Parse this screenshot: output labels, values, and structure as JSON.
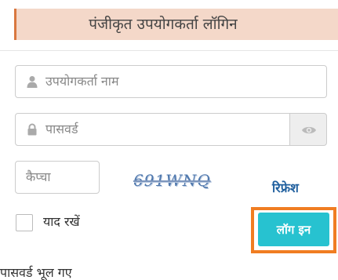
{
  "header": {
    "title": "पंजीकृत उपयोगकर्ता लॉगिन"
  },
  "form": {
    "username": {
      "placeholder": "उपयोगकर्ता नाम",
      "value": "",
      "icon": "user-icon"
    },
    "password": {
      "placeholder": "पासवर्ड",
      "value": "",
      "icon": "lock-icon",
      "toggle_icon": "eye-icon"
    },
    "captcha": {
      "placeholder": "कैप्चा",
      "value": "",
      "image_text": "691WNQ",
      "refresh_label": "रिफ्रेश"
    },
    "remember_me": {
      "label": "याद रखें",
      "checked": false
    },
    "login_button": {
      "label": "लॉग इन"
    },
    "forgot_password": {
      "label": "पासवर्ड भूल गए"
    }
  },
  "colors": {
    "header_background": "#f4d8c9",
    "header_accent": "#d97840",
    "login_button": "#27c2d0",
    "highlight": "#f07d22",
    "captcha_text": "#4f78ad",
    "refresh_link": "#1f5f9e"
  }
}
